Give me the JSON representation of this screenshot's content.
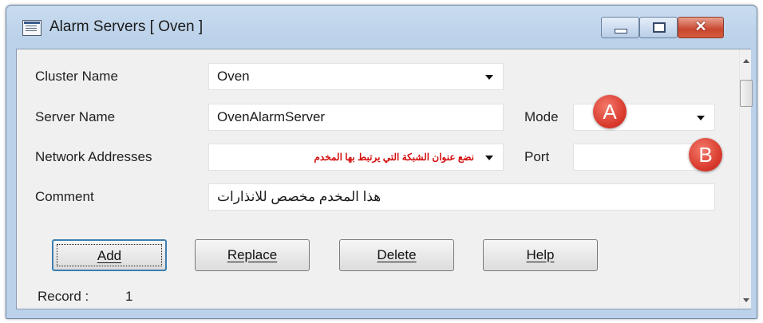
{
  "window": {
    "title": "Alarm Servers [ Oven ]",
    "close_symbol": "✕"
  },
  "form": {
    "cluster_name": {
      "label": "Cluster Name",
      "value": "Oven"
    },
    "server_name": {
      "label": "Server Name",
      "value": "OvenAlarmServer"
    },
    "mode": {
      "label": "Mode",
      "value": ""
    },
    "network_addresses": {
      "label": "Network Addresses",
      "value": "نضع عنوان الشبكة التي يرتبط بها المخدم"
    },
    "port": {
      "label": "Port",
      "value": ""
    },
    "comment": {
      "label": "Comment",
      "value": "هذا المخدم مخصص للانذارات"
    }
  },
  "markers": {
    "a": "A",
    "b": "B"
  },
  "buttons": {
    "add": "Add",
    "replace": "Replace",
    "delete": "Delete",
    "help": "Help"
  },
  "status": {
    "record_label": "Record :",
    "record_value": "1"
  },
  "colors": {
    "annotation_red": "#d8392c",
    "arabic_text_red": "#d41010",
    "default_button_border": "#3c7fb1"
  }
}
